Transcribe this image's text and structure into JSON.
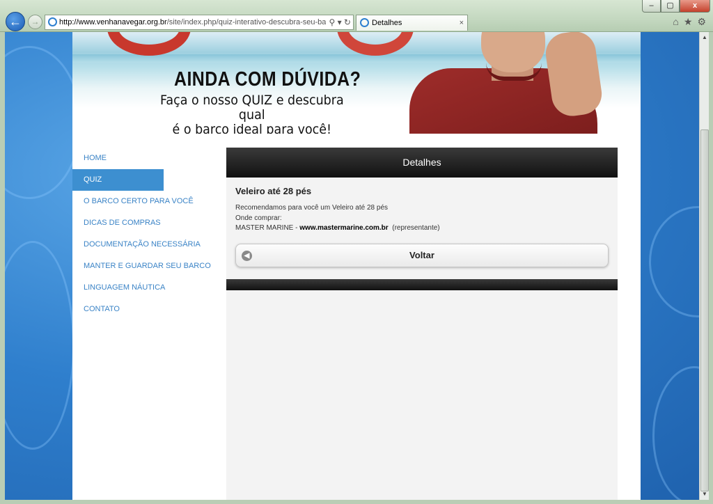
{
  "browser": {
    "url_host": "http://www.venhanavegar.org.br",
    "url_path": "/site/index.php/quiz-interativo-descubra-seu-barco#r_",
    "tab_title": "Detalhes",
    "tab_close": "×",
    "back": "←",
    "forward": "→",
    "window": {
      "minimize": "–",
      "maximize": "▢",
      "close": "x"
    },
    "addr_controls": "⚲ ▾ ↻",
    "icons": [
      "home-icon",
      "favorites-star-icon",
      "tools-gear-icon"
    ],
    "icon_glyphs": {
      "home": "⌂",
      "star": "★",
      "gear": "⚙"
    }
  },
  "banner": {
    "heading": "AINDA COM DÚVIDA?",
    "subheading_1": "Faça o nosso QUIZ e descubra qual",
    "subheading_2": "é o barco ideal para você!"
  },
  "nav": {
    "items": [
      {
        "label": "HOME",
        "active": false
      },
      {
        "label": "QUIZ",
        "active": true
      },
      {
        "label": "O BARCO CERTO PARA VOCÊ",
        "active": false
      },
      {
        "label": "DICAS DE COMPRAS",
        "active": false
      },
      {
        "label": "DOCUMENTAÇÃO NECESSÁRIA",
        "active": false
      },
      {
        "label": "MANTER E GUARDAR SEU BARCO",
        "active": false
      },
      {
        "label": "LINGUAGEM NÁUTICA",
        "active": false
      },
      {
        "label": "CONTATO",
        "active": false
      }
    ]
  },
  "panel": {
    "header": "Detalhes",
    "title": "Veleiro até 28 pés",
    "line1": "Recomendamos para você um Veleiro até 28 pés",
    "line2": "Onde comprar:",
    "dealer": "MASTER MARINE - ",
    "dealer_site": "www.mastermarine.com.br",
    "dealer_role": "(representante)",
    "back_button": "Voltar",
    "back_glyph": "◀"
  },
  "scrollbar": {
    "up": "▲",
    "down": "▼"
  },
  "colors": {
    "nav_link": "#3a83c6",
    "nav_active_bg": "#3d8fd0",
    "panel_header_bg": "#111111",
    "page_bg_blue": "#2f7fcd"
  }
}
